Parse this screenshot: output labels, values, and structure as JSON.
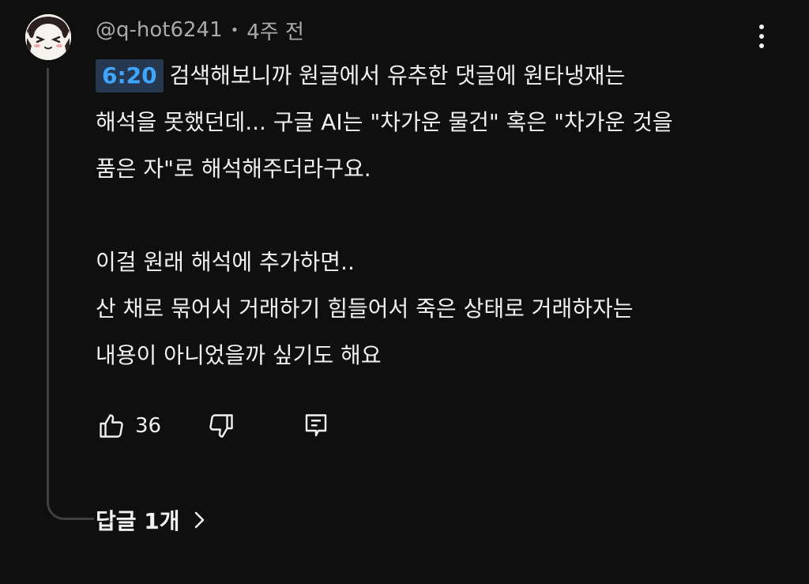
{
  "comment": {
    "author": "@q-hot6241",
    "separator": "•",
    "time_ago": "4주 전",
    "timestamp_link": "6:20",
    "lines": [
      "검색해보니까 원글에서 유추한 댓글에 원타냉재는",
      "해석을 못했던데... 구글 AI는 \"차가운 물건\" 혹은 \"차가운 것을",
      "품은 자\"로 해석해주더라구요.",
      "",
      "이걸 원래 해석에 추가하면..",
      "산 채로 묶어서 거래하기 힘들어서 죽은 상태로 거래하자는",
      "내용이 아니었을까 싶기도 해요"
    ],
    "likes": "36",
    "replies_label": "답글 1개"
  },
  "icons": {
    "more": "vertical-ellipsis-icon",
    "like": "thumbs-up-icon",
    "dislike": "thumbs-down-icon",
    "reply": "reply-icon",
    "chevron": "chevron-right-icon"
  },
  "colors": {
    "background": "#0f0f0f",
    "text": "#f1f1f1",
    "secondary_text": "#aaaaaa",
    "timestamp_link": "#3ea6ff",
    "timestamp_bg": "#263850",
    "thread_line": "#3f3f3f"
  }
}
